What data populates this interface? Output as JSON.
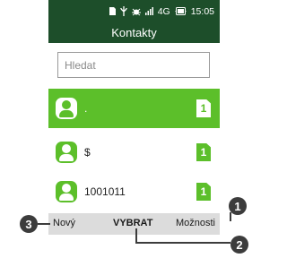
{
  "status_bar": {
    "icons": [
      "sim-icon",
      "usb-icon",
      "bug-icon",
      "signal-icon",
      "battery-icon"
    ],
    "network": "4G",
    "time": "15:05"
  },
  "header": {
    "title": "Kontakty"
  },
  "search": {
    "placeholder": "Hledat"
  },
  "contacts": [
    {
      "name": ".",
      "sim": "1",
      "selected": true
    },
    {
      "name": "$",
      "sim": "1",
      "selected": false
    },
    {
      "name": "1001011",
      "sim": "1",
      "selected": false
    }
  ],
  "softkeys": {
    "left": "Nový",
    "center": "VYBRAT",
    "right": "Možnosti"
  },
  "callouts": {
    "one": "1",
    "two": "2",
    "three": "3"
  },
  "colors": {
    "header_bg": "#1d4e2a",
    "accent": "#5cbf2a",
    "softbar_bg": "#dcdcdc",
    "callout_bg": "#3c3c3c"
  }
}
